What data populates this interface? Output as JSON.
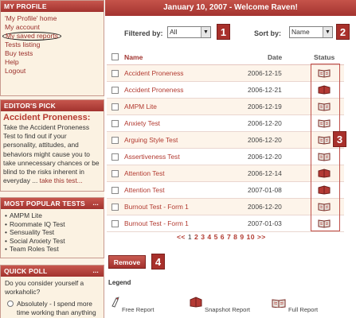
{
  "header": {
    "title": "January 10, 2007 - Welcome Raven!"
  },
  "sidebar": {
    "profile": {
      "title": "MY PROFILE",
      "items": [
        {
          "label": "'My Profile' home"
        },
        {
          "label": "My account"
        },
        {
          "label": "My saved reports"
        },
        {
          "label": "Tests listing"
        },
        {
          "label": "Buy tests"
        },
        {
          "label": "Help"
        },
        {
          "label": "Logout"
        }
      ]
    },
    "editors_pick": {
      "title": "EDITOR'S PICK",
      "heading": "Accident Proneness:",
      "text": "Take the Accident Proneness Test to find out if your personality, attitudes, and behaviors might cause you to take unnecessary chances or be blind to the risks inherent in everyday ...",
      "link": "take this test..."
    },
    "popular": {
      "title": "MOST POPULAR TESTS",
      "more": "...",
      "items": [
        "AMPM Lite",
        "Roommate IQ Test",
        "Sensuality Test",
        "Social Anxiety Test",
        "Team Roles Test"
      ]
    },
    "poll": {
      "title": "QUICK POLL",
      "more": "...",
      "question": "Do you consider yourself a workaholic?",
      "option": "Absolutely - I spend more time working than anything"
    }
  },
  "filters": {
    "filter_label": "Filtered by:",
    "filter_value": "All",
    "sort_label": "Sort by:",
    "sort_value": "Name"
  },
  "callouts": [
    "1",
    "2",
    "3",
    "4"
  ],
  "table": {
    "headers": {
      "name": "Name",
      "date": "Date",
      "status": "Status"
    },
    "rows": [
      {
        "name": "Accident Proneness",
        "date": "2006-12-15",
        "status": "full"
      },
      {
        "name": "Accident Proneness",
        "date": "2006-12-21",
        "status": "snapshot"
      },
      {
        "name": "AMPM Lite",
        "date": "2006-12-19",
        "status": "full"
      },
      {
        "name": "Anxiety Test",
        "date": "2006-12-20",
        "status": "full"
      },
      {
        "name": "Arguing Style Test",
        "date": "2006-12-20",
        "status": "full"
      },
      {
        "name": "Assertiveness Test",
        "date": "2006-12-20",
        "status": "full"
      },
      {
        "name": "Attention Test",
        "date": "2006-12-14",
        "status": "snapshot"
      },
      {
        "name": "Attention Test",
        "date": "2007-01-08",
        "status": "snapshot"
      },
      {
        "name": "Burnout Test - Form 1",
        "date": "2006-12-20",
        "status": "full"
      },
      {
        "name": "Burnout Test - Form 1",
        "date": "2007-01-03",
        "status": "full"
      }
    ]
  },
  "pager": {
    "prev": "<<",
    "pages": [
      "1",
      "2",
      "3",
      "4",
      "5",
      "6",
      "7",
      "8",
      "9",
      "10"
    ],
    "next": ">>",
    "current": "1"
  },
  "actions": {
    "remove": "Remove"
  },
  "legend": {
    "title": "Legend",
    "items": [
      {
        "label": "Free Report",
        "icon": "free-report-icon"
      },
      {
        "label": "Snapshot Report",
        "icon": "snapshot-report-icon"
      },
      {
        "label": "Full Report",
        "icon": "full-report-icon"
      }
    ]
  },
  "colors": {
    "brand": "#a8302b",
    "link": "#b23a30",
    "sidebar_bg": "#fbf2e2"
  }
}
